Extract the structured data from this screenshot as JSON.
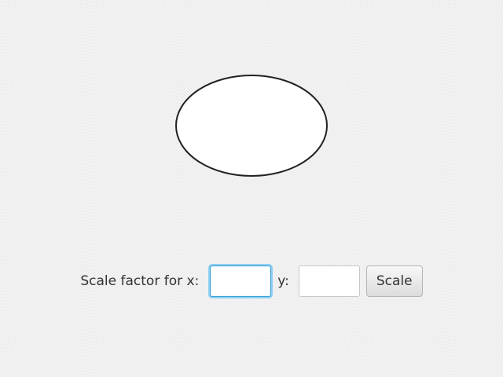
{
  "form": {
    "x_label": "Scale factor for x:",
    "x_value": "",
    "y_label": "y:",
    "y_value": "",
    "scale_button_label": "Scale"
  },
  "shape": {
    "type": "ellipse",
    "fill": "#ffffff",
    "stroke": "#222222"
  },
  "colors": {
    "focus_ring": "#3aa0d8"
  }
}
